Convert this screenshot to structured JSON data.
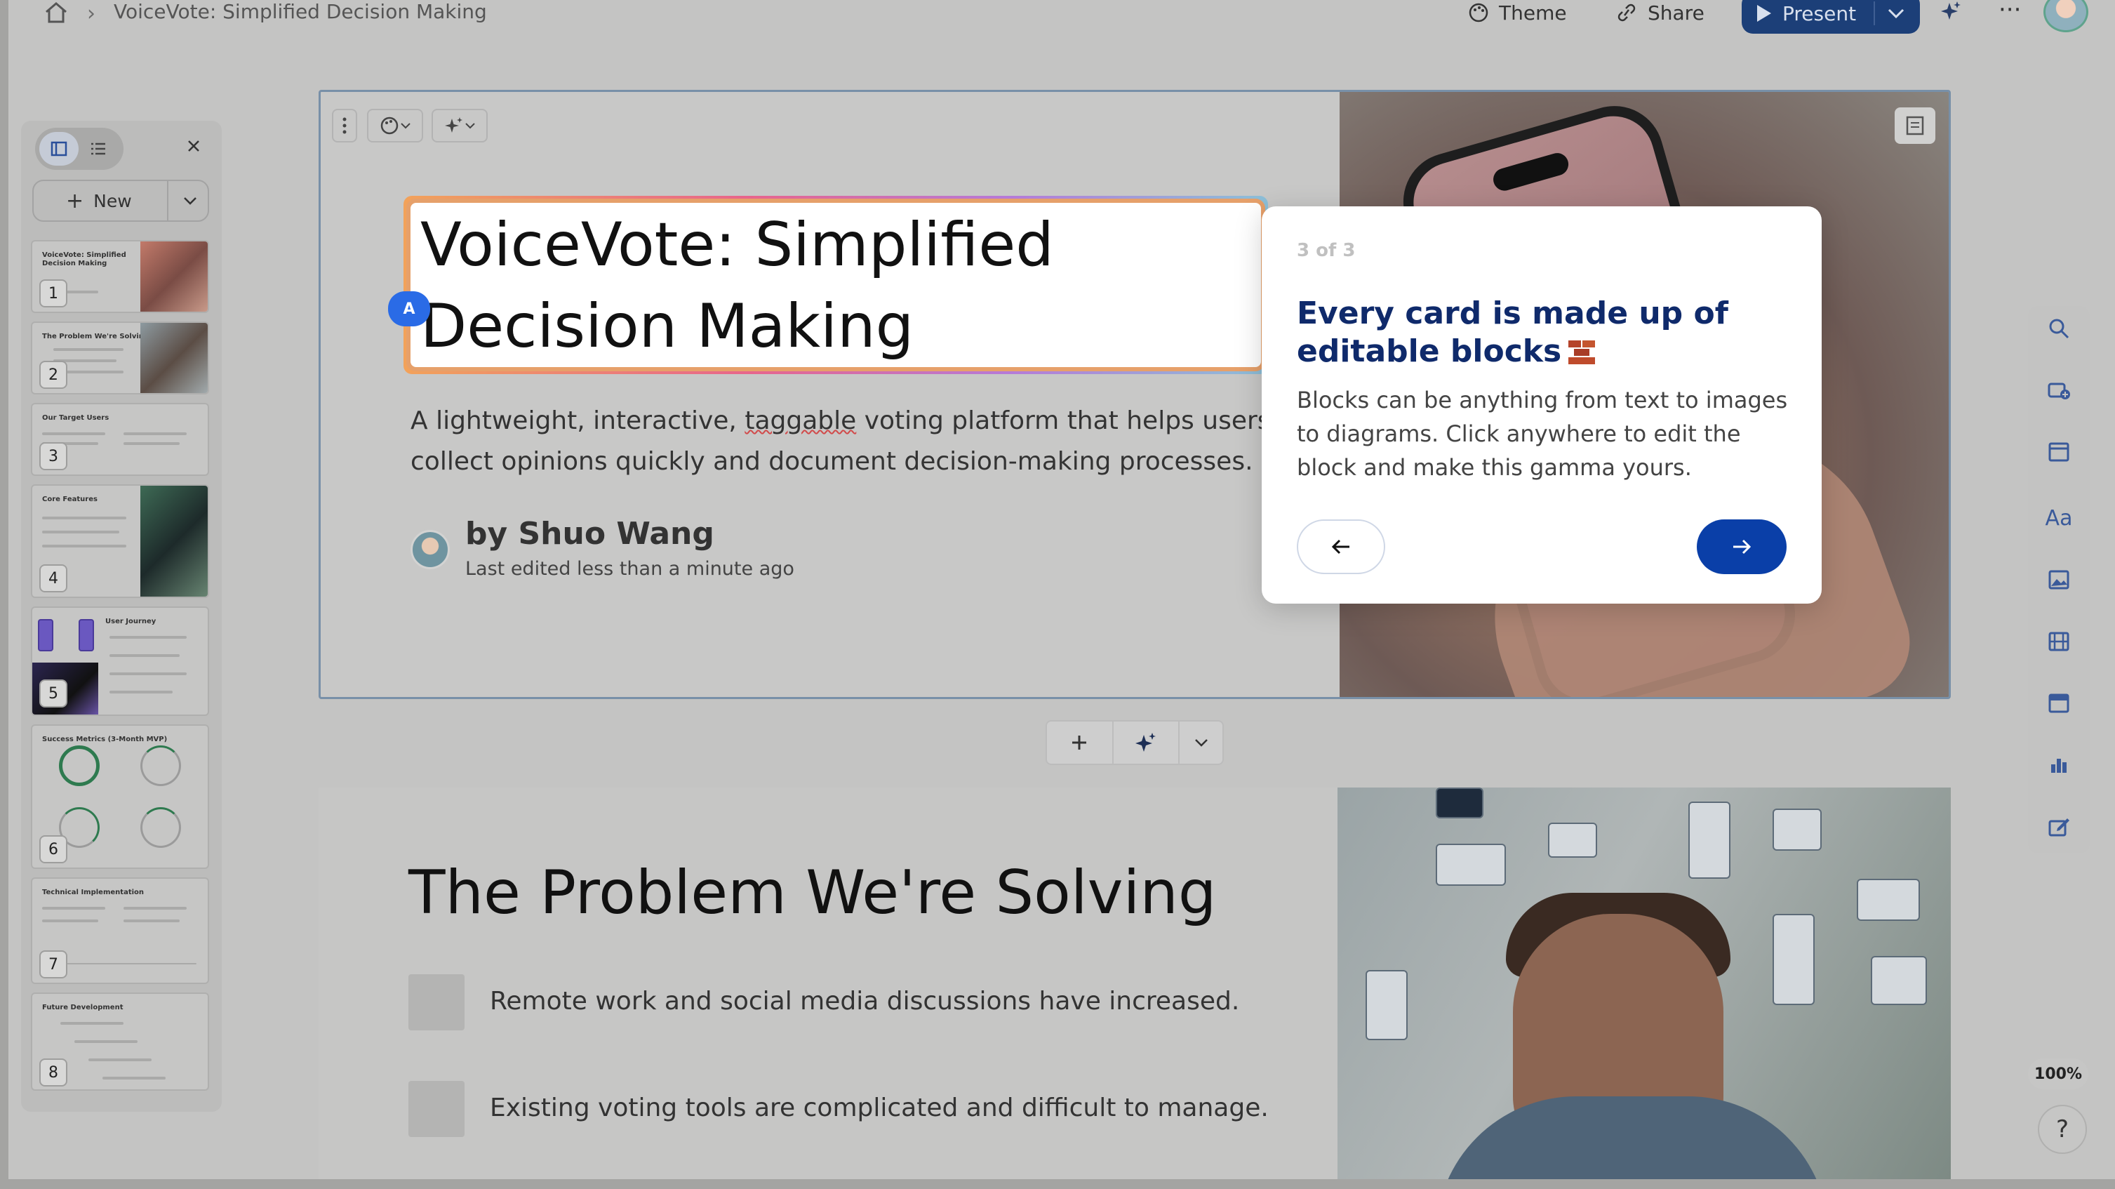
{
  "header": {
    "breadcrumb_title": "VoiceVote: Simplified Decision Making",
    "theme_label": "Theme",
    "share_label": "Share",
    "present_label": "Present"
  },
  "sidebar": {
    "new_label": "New",
    "slides": [
      {
        "number": "1",
        "title": "VoiceVote: Simplified Decision Making"
      },
      {
        "number": "2",
        "title": "The Problem We're Solving"
      },
      {
        "number": "3",
        "title": "Our Target Users"
      },
      {
        "number": "4",
        "title": "Core Features"
      },
      {
        "number": "5",
        "title": "User Journey"
      },
      {
        "number": "6",
        "title": "Success Metrics (3-Month MVP)"
      },
      {
        "number": "7",
        "title": "Technical Implementation"
      },
      {
        "number": "8",
        "title": "Future Development"
      }
    ]
  },
  "card1": {
    "title": "VoiceVote: Simplified Decision Making",
    "title_line1": "VoiceVote: Simplified",
    "title_line2": "Decision Making",
    "collab_badge": "A",
    "subtitle_pre": "A lightweight, interactive, ",
    "subtitle_misspelled": "taggable",
    "subtitle_post": " voting platform that helps users collect opinions quickly and document decision-making processes.",
    "byline": "by Shuo Wang",
    "edited": "Last edited less than a minute ago"
  },
  "card2": {
    "title": "The Problem We're Solving",
    "bullets": [
      "Remote work and social media discussions have increased.",
      "Existing voting tools are complicated and difficult to manage."
    ]
  },
  "popover": {
    "step": "3 of 3",
    "title": "Every card is made up of editable blocks",
    "body": "Blocks can be anything from text to images to diagrams. Click anywhere to edit the block and make this gamma yours."
  },
  "zoom_level": "100%",
  "help_label": "?",
  "colors": {
    "present_button": "#1c3f78",
    "popover_next": "#0a3fa8",
    "popover_title": "#0f2a6b",
    "collab_badge": "#2a6be6"
  }
}
